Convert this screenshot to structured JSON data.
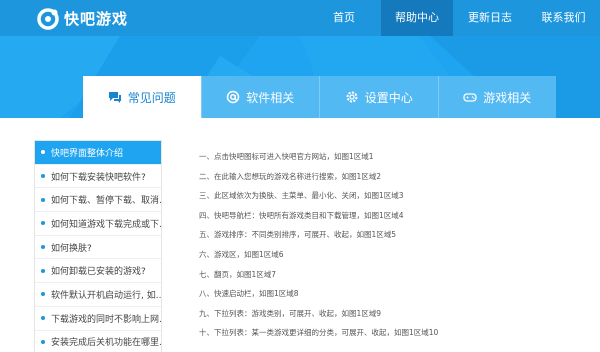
{
  "app": {
    "logo_text": "快吧游戏"
  },
  "nav": [
    {
      "label": "首页",
      "active": false
    },
    {
      "label": "帮助中心",
      "active": true
    },
    {
      "label": "更新日志",
      "active": false
    },
    {
      "label": "联系我们",
      "active": false
    }
  ],
  "tabs": [
    {
      "label": "常见问题",
      "icon": "chat-icon",
      "active": true
    },
    {
      "label": "软件相关",
      "icon": "at-icon",
      "active": false
    },
    {
      "label": "设置中心",
      "icon": "gear-icon",
      "active": false
    },
    {
      "label": "游戏相关",
      "icon": "gamepad-icon",
      "active": false
    }
  ],
  "sidebar": {
    "items": [
      {
        "label": "快吧界面整体介绍",
        "active": true
      },
      {
        "label": "如何下载安装快吧软件?",
        "active": false
      },
      {
        "label": "如何下载、暂停下载、取消...",
        "active": false
      },
      {
        "label": "如何知道游戏下载完成或下...",
        "active": false
      },
      {
        "label": "如何换肤?",
        "active": false
      },
      {
        "label": "如何卸载已安装的游戏?",
        "active": false
      },
      {
        "label": "软件默认开机启动运行, 如...",
        "active": false
      },
      {
        "label": "下载游戏的同时不影响上网...",
        "active": false
      },
      {
        "label": "安装完成后关机功能在哪里...",
        "active": false
      }
    ]
  },
  "content": {
    "lines": [
      "一、点击快吧图标可进入快吧官方网站，如图1区域1",
      "二、在此输入您想玩的游戏名称进行搜索，如图1区域2",
      "三、此区域依次为换肤、主菜单、最小化、关闭，如图1区域3",
      "四、快吧导航栏：快吧所有游戏类目和下载管理，如图1区域4",
      "五、游戏排序：不同类别排序，可展开、收起，如图1区域5",
      "六、游戏区，如图1区域6",
      "七、翻页，如图1区域7",
      "八、快速启动栏，如图1区域8",
      "九、下拉列表：游戏类别，可展开、收起，如图1区域9",
      "十、下拉列表：某一类游戏更详细的分类，可展开、收起，如图1区域10"
    ]
  },
  "colors": {
    "nav_bg": "#1d96dd",
    "nav_active": "#1479bd",
    "banner": "#1ea4f0",
    "tab_inactive": "#52b9f3"
  }
}
